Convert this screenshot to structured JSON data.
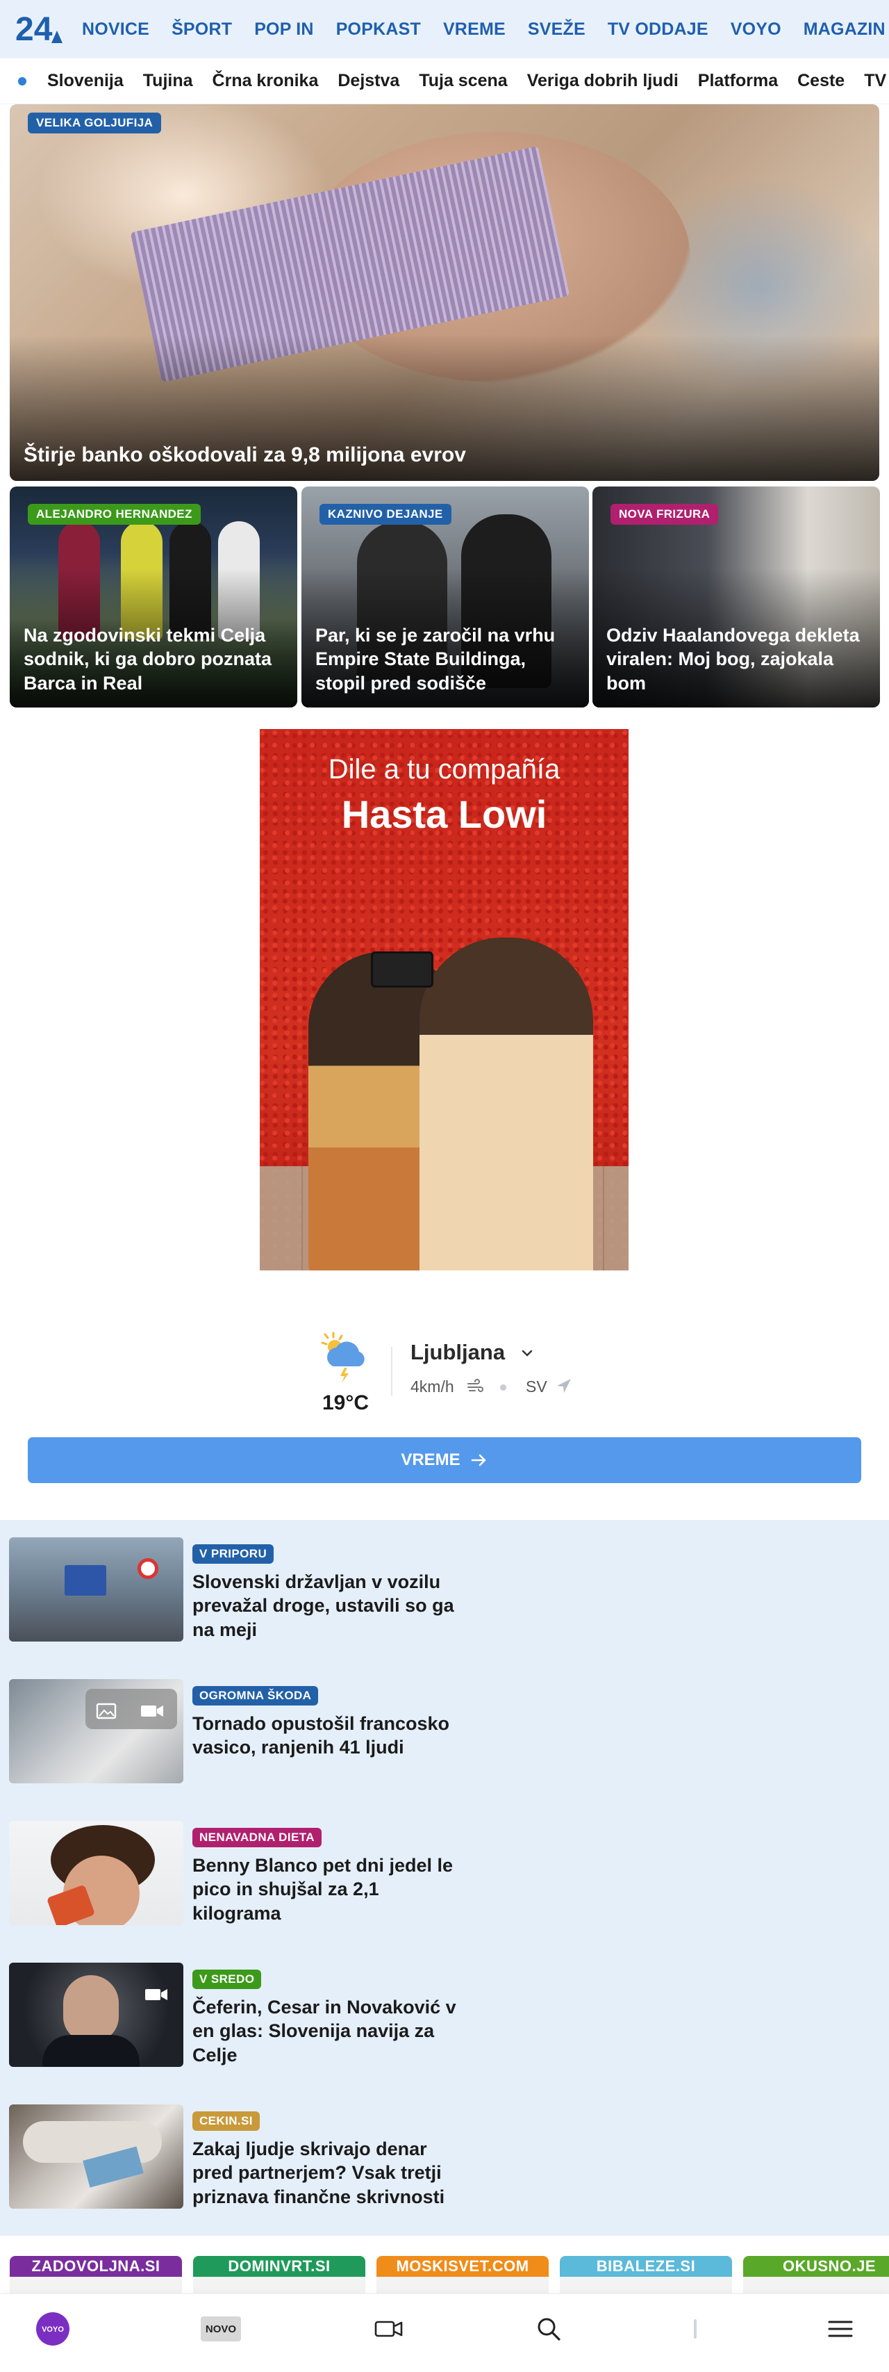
{
  "brand": {
    "logo_text": "24",
    "accent": "#1f5fae"
  },
  "top_nav": [
    "NOVICE",
    "ŠPORT",
    "POP IN",
    "POPKAST",
    "VREME",
    "SVEŽE",
    "TV ODDAJE",
    "VOYO",
    "MAGAZIN"
  ],
  "sub_nav": [
    "Slovenija",
    "Tujina",
    "Črna kronika",
    "Dejstva",
    "Tuja scena",
    "Veriga dobrih ljudi",
    "Platforma",
    "Ceste",
    "TV spor"
  ],
  "hero": {
    "badge": "VELIKA GOLJUFIJA",
    "badge_color": "#2261a8",
    "title": "Štirje banko oškodovali za 9,8 milijona evrov"
  },
  "cards": [
    {
      "badge": "ALEJANDRO HERNANDEZ",
      "badge_color": "#3c9a1b",
      "title": "Na zgodovinski tekmi Celja sodnik, ki ga dobro poznata Barca in Real"
    },
    {
      "badge": "KAZNIVO DEJANJE",
      "badge_color": "#2261a8",
      "title": "Par, ki se je zaročil na vrhu Empire State Buildinga, stopil pred sodišče"
    },
    {
      "badge": "NOVA FRIZURA",
      "badge_color": "#b0206e",
      "title": "Odziv Haalandovega dekleta viralen: Moj bog, zajokala bom"
    }
  ],
  "ad": {
    "line1": "Dile a tu compañía",
    "line2": "Hasta Lowi"
  },
  "weather": {
    "temperature": "19°C",
    "city": "Ljubljana",
    "wind": "4km/h",
    "direction": "SV",
    "button_label": "VREME"
  },
  "articles": [
    {
      "badge": "V PRIPORU",
      "badge_color": "#2261a8",
      "title": "Slovenski državljan v vozilu prevažal droge, ustavili so ga na meji"
    },
    {
      "badge": "OGROMNA ŠKODA",
      "badge_color": "#2261a8",
      "title": "Tornado opustošil francosko vasico, ranjenih 41 ljudi"
    },
    {
      "badge": "NENAVADNA DIETA",
      "badge_color": "#b0206e",
      "title": "Benny Blanco pet dni jedel le pico in shujšal za 2,1 kilograma"
    },
    {
      "badge": "V SREDO",
      "badge_color": "#3c9a1b",
      "title": "Čeferin, Cesar in Novaković v en glas: Slovenija navija za Celje"
    },
    {
      "badge": "CEKIN.SI",
      "badge_color": "#c99a3a",
      "title": "Zakaj ljudje skrivajo denar pred partnerjem? Vsak tretji priznava finančne skrivnosti"
    }
  ],
  "partners": [
    {
      "name": "ZADOVOLJNA.SI",
      "color": "#7a2d9c"
    },
    {
      "name": "DOMINVRT.SI",
      "color": "#1f9a5a"
    },
    {
      "name": "MOSKISVET.COM",
      "color": "#f08c1a"
    },
    {
      "name": "BIBALEZE.SI",
      "color": "#5bb9d9"
    },
    {
      "name": "OKUSNO.JE",
      "color": "#5aa82a"
    }
  ],
  "bottom_bar": {
    "voyo": "VOYO",
    "novo": "NOVO"
  },
  "icons": [
    "logo-24",
    "weather-cloud-sun-rain-icon",
    "chevron-down-icon",
    "wind-icon",
    "direction-arrow-icon",
    "arrow-right-icon",
    "gallery-icon",
    "video-icon",
    "search-icon",
    "menu-icon"
  ]
}
